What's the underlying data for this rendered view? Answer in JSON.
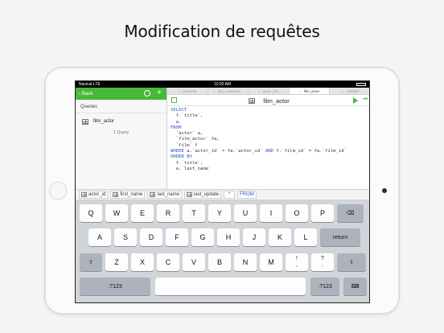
{
  "headline": "Modification de requêtes",
  "status": {
    "carrier": "Navicat LTE",
    "time": "10:20 AM"
  },
  "sidebar": {
    "back_label": "Back",
    "section": "Queries",
    "items": [
      {
        "label": "film_actor"
      }
    ],
    "count": "1 Query"
  },
  "tabs": [
    {
      "label": "customer",
      "active": false
    },
    {
      "label": "get_customer...",
      "active": false
    },
    {
      "label": "actor_info",
      "active": false
    },
    {
      "label": "film_actor",
      "active": true
    },
    {
      "label": "Untitled",
      "active": false
    }
  ],
  "editor": {
    "title": "film_actor"
  },
  "code_lines": [
    [
      {
        "t": "SELECT",
        "kw": true
      }
    ],
    [
      {
        "t": "  f.`title`,",
        "kw": false
      }
    ],
    [
      {
        "t": "  a.",
        "kw": false
      }
    ],
    [
      {
        "t": "FROM",
        "kw": true
      }
    ],
    [
      {
        "t": "  `actor` a,",
        "kw": false
      }
    ],
    [
      {
        "t": "  `film_actor` fa,",
        "kw": false
      }
    ],
    [
      {
        "t": "  `film` f",
        "kw": false
      }
    ],
    [
      {
        "t": "WHERE",
        "kw": true
      },
      {
        "t": " a.`actor_id` = fa.`actor_id` ",
        "kw": false
      },
      {
        "t": "AND",
        "kw": true
      },
      {
        "t": " f.`film_id` = fa.`film_id`",
        "kw": false
      }
    ],
    [
      {
        "t": "ORDER BY",
        "kw": true
      }
    ],
    [
      {
        "t": "  f.`title`,",
        "kw": false
      }
    ],
    [
      {
        "t": "  a.`last_name`",
        "kw": false
      }
    ]
  ],
  "suggestions": [
    {
      "label": "actor_id",
      "icon": true,
      "kw": false
    },
    {
      "label": "first_name",
      "icon": true,
      "kw": false
    },
    {
      "label": "last_name",
      "icon": true,
      "kw": false
    },
    {
      "label": "last_update",
      "icon": true,
      "kw": false
    },
    {
      "label": "*",
      "icon": false,
      "kw": false
    },
    {
      "label": "FROM",
      "icon": false,
      "kw": true
    }
  ],
  "keyboard": {
    "row1": [
      "Q",
      "W",
      "E",
      "R",
      "T",
      "Y",
      "U",
      "I",
      "O",
      "P"
    ],
    "row2": [
      "A",
      "S",
      "D",
      "F",
      "G",
      "H",
      "J",
      "K",
      "L"
    ],
    "row3": [
      "Z",
      "X",
      "C",
      "V",
      "B",
      "N",
      "M"
    ],
    "punct1": [
      "!",
      ","
    ],
    "punct2": [
      "?",
      "."
    ],
    "return_label": "return",
    "numbers_label": ".?123"
  }
}
